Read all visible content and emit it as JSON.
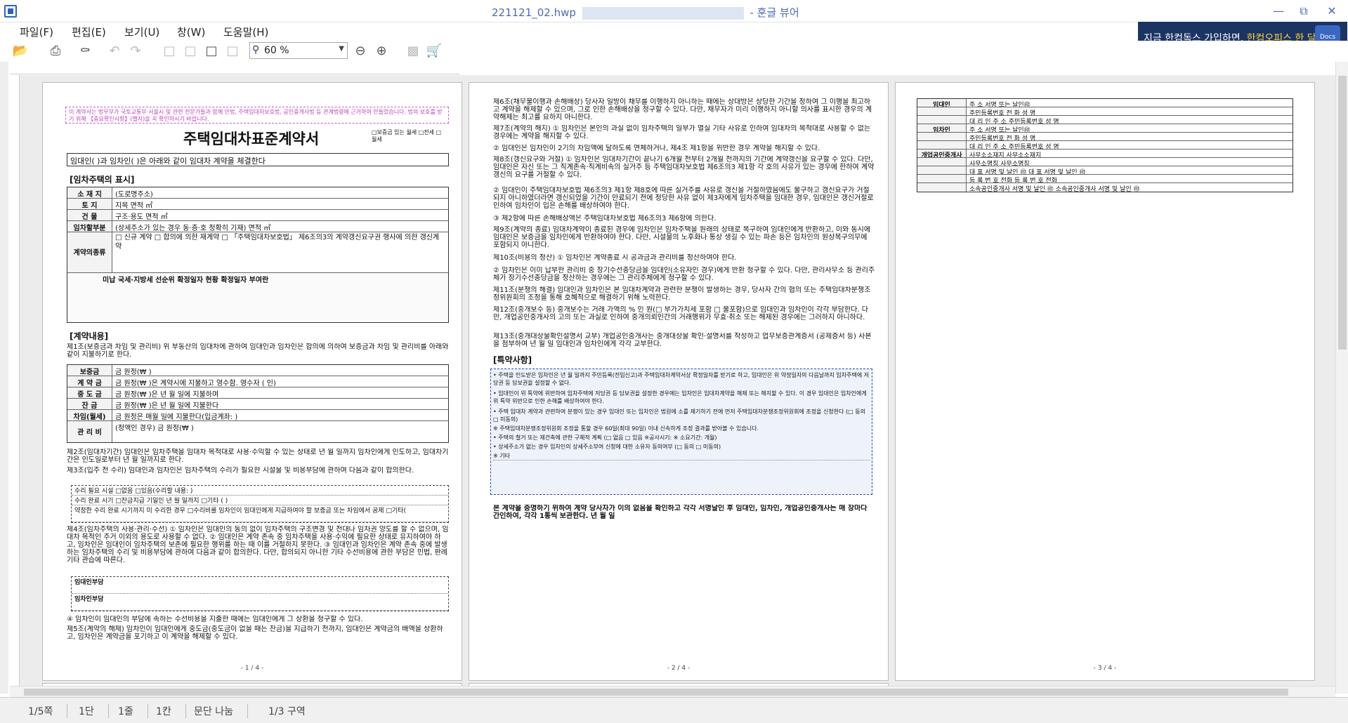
{
  "window": {
    "filename": "221121_02.hwp",
    "app_name": "- 훈글 뷰어"
  },
  "menu": [
    "파일(F)",
    "편집(E)",
    "보기(U)",
    "창(W)",
    "도움말(H)"
  ],
  "toolbar": {
    "zoom": "60 %"
  },
  "ad": {
    "text1": "지금 한컴독스 가입하면, ",
    "text2": "한컴오피스 한 달 무료!",
    "logo": "Docs"
  },
  "status": [
    "1/5쪽",
    "1단",
    "1줄",
    "1칸",
    "문단 나눔",
    "1/3 구역"
  ],
  "page1": {
    "notice": "이 계약서는 법무부가 국토교통부·서울시 및 관련 전문가들과 함께 민법, 주택임대차보호법, 공인중개사법 등 관계법령에 근거하여 만들었습니다. 법의 보호를 받기 위해 【중요확인사항】(별지)을 꼭 확인하시기 바랍니다.",
    "title": "주택임대차표준계약서",
    "checks": "□보증금 있는 월세 □전세 □월세",
    "party": "임대인(                              )과 임차인(                              )은 아래와 같이 임대차 계약을 체결한다",
    "sec1": "[임차주택의 표시]",
    "rows": [
      [
        "소 재 지",
        "(도로명주소)"
      ],
      [
        "토 지",
        "지목                                        면적                              ㎡"
      ],
      [
        "건 물",
        "구조·용도                                  면적                              ㎡"
      ],
      [
        "임차할부분",
        "(상세주소가 있는 경우 동·층·호 정확히 기재)    면적                    ㎡"
      ],
      [
        "계약의종류",
        "□ 신규 계약   □ 합의에 의한 재계약   □ 「주택임대차보호법」 제6조의3의 계약갱신요구권 행사에 의한 갱신계약"
      ]
    ],
    "fixed": "미납 국세·지방세          선순위 확정일자 현황          확정일자 부여란",
    "sec2": "[계약내용]",
    "art1": "제1조(보증금과 차임 및 관리비) 위 부동산의 임대차에 관하여 임대인과 임차인은 합의에 의하여 보증금과 차임 및 관리비를 아래와 같이 지불하기로 한다.",
    "pay": [
      [
        "보증금",
        "금                           원정(₩                          )"
      ],
      [
        "계 약 금",
        "금              원정(₩             )은 계약시에 지불하고 영수함. 영수자 (          인)"
      ],
      [
        "중 도 금",
        "금              원정(₩             )은       년      월      일에 지불하며"
      ],
      [
        "잔 금",
        "금              원정(₩             )은       년      월      일에 지불한다"
      ],
      [
        "차임(월세)",
        "금              원정은 매월      일에 지불한다(입금계좌:                    )"
      ],
      [
        "관 리 비",
        "(정액인 경우) 금                       원정(₩                    )"
      ]
    ],
    "art2": "제2조(임대차기간) 임대인은 임차주택을 임대차 목적대로 사용·수익할 수 있는 상태로      년     월     일까지 임차인에게 인도하고, 임대차기간은 인도일로부터      년      월      일까지로 한다.",
    "art3": "제3조(입주 전 수리) 임대인과 임차인은 임차주택의 수리가 필요한 시설물 및 비용부담에 관하여 다음과 같이 합의한다.",
    "repair": [
      "수리 필요 시설   □없음 □있음(수리할 내용:                                      )",
      "수리 완료 시기   □잔금지급 기일인      년     월     일까지 □기타 (                 )",
      "약정한 수리 완료 시기까지 미 수리한 경우   □수리비를 임차인이 임대인에게 지급하여야 할 보증금 또는 차임에서 공제 □기타("
    ],
    "art4": "제4조(임차주택의 사용·관리·수선) ① 임차인은 임대인의 동의 없이 임차주택의 구조변경 및 전대나 임차권 양도를 할 수 없으며, 임대차 목적인 주거 이외의 용도로 사용할 수 없다. ② 임대인은 계약 존속 중 임차주택을 사용·수익에 필요한 상태로 유지하여야 하고, 임차인은 임대인이 임차주택의 보존에 필요한 행위를 하는 때 이를 거절하지 못한다. ③ 임대인과 임차인은 계약 존속 중에 발생하는 임차주택의 수리 및 비용부담에 관하여 다음과 같이 합의한다. 다만, 합의되지 아니한 기타 수선비용에 관한 부담은 민법, 판례 기타 관습에 따른다.",
    "burden": [
      "임대인부담",
      "임차인부담"
    ],
    "art4b": "④ 임차인이 임대인의 부담에 속하는 수선비용을 지출한 때에는 임대인에게 그 상환을 청구할 수 있다.",
    "art5": "제5조(계약의 해제) 임차인이 임대인에게 중도금(중도금이 없을 때는 잔금)을 지급하기 전까지, 임대인은 계약금의 배액을 상환하고, 임차인은 계약금을 포기하고 이 계약을 해제할 수 있다.",
    "pnum": "- 1 / 4 -"
  },
  "page2": {
    "articles": [
      "제6조(채무불이행과 손해배상) 당사자 일방이 채무를 이행하지 아니하는 때에는 상대방은 상당한 기간을 정하여 그 이행을 최고하고 계약을 해제할 수 있으며, 그로 인한 손해배상을 청구할 수 있다. 다만, 채무자가 미리 이행하지 아니할 의사를 표시한 경우의 계약해제는 최고를 요하지 아니한다.",
      "제7조(계약의 해지) ① 임차인은 본인의 과실 없이 임차주택의 일부가 멸실 기타 사유로 인하여 임대차의 목적대로 사용할 수 없는 경우에는 계약을 해지할 수 있다.",
      "② 임대인은 임차인이 2기의 차임액에 달하도록 연체하거나, 제4조 제1항을 위반한 경우 계약을 해지할 수 있다.",
      "제8조(갱신요구와 거절) ① 임차인은 임대차기간이 끝나기 6개월 전부터 2개월 전까지의 기간에 계약갱신을 요구할 수 있다. 다만, 임대인은 자신 또는 그 직계존속·직계비속의 실거주 등 주택임대차보호법 제6조의3 제1항 각 호의 사유가 있는 경우에 한하여 계약갱신의 요구를 거절할 수 있다.",
      "② 임대인이 주택임대차보호법 제6조의3 제1항 제8호에 따른 실거주를 사유로 갱신을 거절하였음에도 불구하고 갱신요구가 거절되지 아니하였더라면 갱신되었을 기간이 만료되기 전에 정당한 사유 없이 제3자에게 임차주택을 임대한 경우, 임대인은 갱신거절로 인하여 임차인이 입은 손해를 배상하여야 한다.",
      "③ 제2항에 따른 손해배상액은 주택임대차보호법 제6조의3 제6항에 의한다.",
      "제9조(계약의 종료) 임대차계약이 종료된 경우에 임차인은 임차주택을 원래의 상태로 복구하여 임대인에게 반환하고, 이와 동시에 임대인은 보증금을 임차인에게 반환하여야 한다. 다만, 시설물의 노후화나 통상 생길 수 있는 파손 등은 임차인의 원상복구의무에 포함되지 아니한다.",
      "제10조(비용의 정산) ① 임차인은 계약종료 시 공과금과 관리비를 정산하여야 한다.",
      "② 임차인은 이미 납부한 관리비 중 장기수선충당금을 임대인(소유자인 경우)에게 반환 청구할 수 있다. 다만, 관리사무소 등 관리주체가 장기수선충당금을 정산하는 경우에는 그 관리주체에게 청구할 수 있다.",
      "제11조(분쟁의 해결) 임대인과 임차인은 본 임대차계약과 관련한 분쟁이 발생하는 경우, 당사자 간의 협의 또는 주택임대차분쟁조정위원회의 조정을 통해 호혜적으로 해결하기 위해 노력한다.",
      "제12조(중개보수 등) 중개보수는 거래 가액의       % 인           원(□ 부가가치세 포함 □ 불포함)으로 임대인과 임차인이 각각 부담한다. 다만, 개업공인중개사의 고의 또는 과실로 인하여 중개의뢰인간의 거래행위가 무효·취소 또는 해제된 경우에는 그러하지 아니하다.",
      "제13조(중개대상물확인설명서 교부) 개업공인중개사는 중개대상물 확인·설명서를 작성하고 업무보증관계증서 (공제증서 등) 사본을 첨부하여        년      월      일 임대인과 임차인에게 각각 교부한다."
    ],
    "special_title": "[특약사항]",
    "special": [
      "• 주택을 인도받은 임차인은      년     월     일까지 주민등록(전입신고)과 주택임대차계약서상 확정일자를 받기로 하고, 임대인은 위 약정일자의 다음날까지 임차주택에 저당권 등 담보권을 설정할 수 없다.",
      "• 임대인이 위 특약에 위반하여 임차주택에 저당권 등 담보권을 설정한 경우에는 임차인은 임대차계약을 해제 또는 해지할 수 있다. 이 경우 임대인은 임차인에게 위 특약 위반으로 인한 손해를 배상하여야 한다.",
      "• 주택 임대차 계약과 관련하여 분쟁이 있는 경우 임대인 또는 임차인은 법원에 소를 제기하기 전에 먼저 주택임대차분쟁조정위원회에 조정을 신청한다 (□ 동의   □ 미동의)",
      "※ 주택임대차분쟁조정위원회 조정을 통할 경우 60일(최대 90일) 이내 신속하게 조정 결과를 받아볼 수 있습니다.",
      "• 주택의 철거 또는 재건축에 관한 구체적 계획 (□ 없음 □ 있음 ※공사시기:         ※ 소요기간:        개월)",
      "• 상세주소가 없는 경우 임차인의 상세주소부여 신청에 대한 소유자 동의여부 (□ 동의   □ 미동의)",
      "※ 기타"
    ],
    "closing": "본 계약을 증명하기 위하여 계약 당사자가 이의 없음을 확인하고 각각 서명날인 후 임대인, 임차인, 개업공인중개사는 매 장마다 간인하여, 각각 1통씩 보관한다.                    년      월      일",
    "pnum": "- 2 / 4 -"
  },
  "page3": {
    "rows": [
      [
        "임대인",
        "주    소                                                              서명 또는 날인㊞"
      ],
      [
        "",
        "주민등록번호                     전    화                 성  명"
      ],
      [
        "",
        "대 리 인   주 소                  주민등록번호                 성  명"
      ],
      [
        "임차인",
        "주    소                                                              서명 또는 날인㊞"
      ],
      [
        "",
        "주민등록번호                     전    화                 성  명"
      ],
      [
        "",
        "대 리 인   주 소                  주민등록번호                 성  명"
      ],
      [
        "개업공인중개사",
        "사무소소재지                         사무소소재지"
      ],
      [
        "",
        "사무소명칭                           사무소명칭"
      ],
      [
        "",
        "대    표   서명 및 날인   ㊞        대    표   서명 및 날인   ㊞"
      ],
      [
        "",
        "등 록 번 호          전화            등 록 번 호          전화"
      ],
      [
        "",
        "소속공인중개사   서명 및 날인   ㊞   소속공인중개사   서명 및 날인   ㊞"
      ]
    ],
    "pnum": "- 3 / 4 -"
  }
}
